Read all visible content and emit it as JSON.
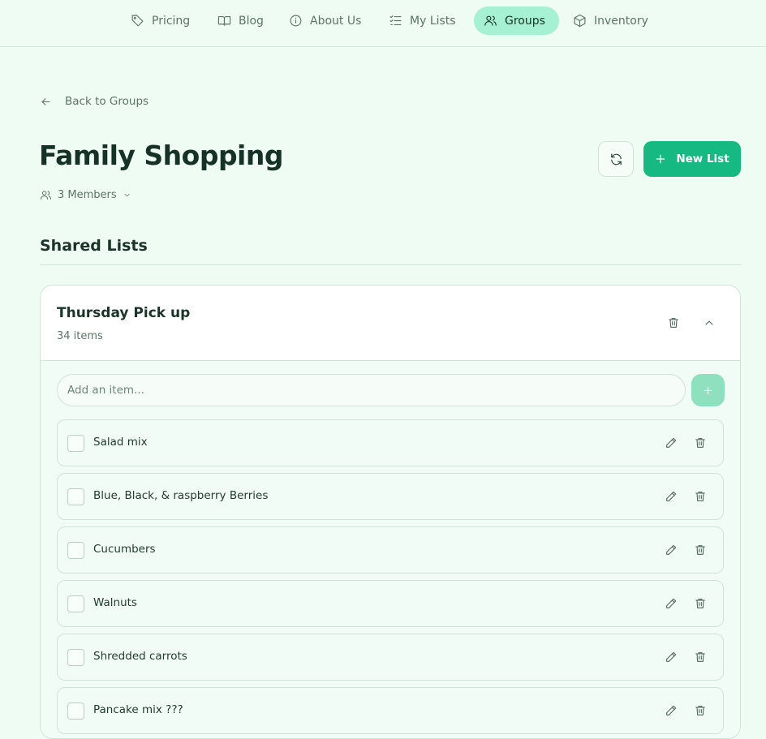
{
  "nav": {
    "items": [
      {
        "label": "Pricing",
        "icon": "tag-icon"
      },
      {
        "label": "Blog",
        "icon": "book-icon"
      },
      {
        "label": "About Us",
        "icon": "info-icon"
      },
      {
        "label": "My Lists",
        "icon": "list-icon"
      },
      {
        "label": "Groups",
        "icon": "users-icon",
        "active": true
      },
      {
        "label": "Inventory",
        "icon": "box-icon"
      }
    ]
  },
  "back_label": "Back to Groups",
  "group": {
    "title": "Family Shopping",
    "members_label": "3 Members"
  },
  "actions": {
    "new_list_label": "New List"
  },
  "section_title": "Shared Lists",
  "list": {
    "title": "Thursday Pick up",
    "count_label": "34 items",
    "add_placeholder": "Add an item...",
    "items": [
      {
        "label": "Salad mix",
        "checked": false
      },
      {
        "label": "Blue, Black, & raspberry Berries",
        "checked": false
      },
      {
        "label": "Cucumbers",
        "checked": false
      },
      {
        "label": "Walnuts",
        "checked": false
      },
      {
        "label": "Shredded carrots",
        "checked": false
      },
      {
        "label": "Pancake mix ???",
        "checked": false
      }
    ]
  },
  "colors": {
    "background": "#effcf4",
    "accent": "#16b981",
    "active_nav": "#a6f0d3",
    "add_button": "#8fe0be"
  }
}
